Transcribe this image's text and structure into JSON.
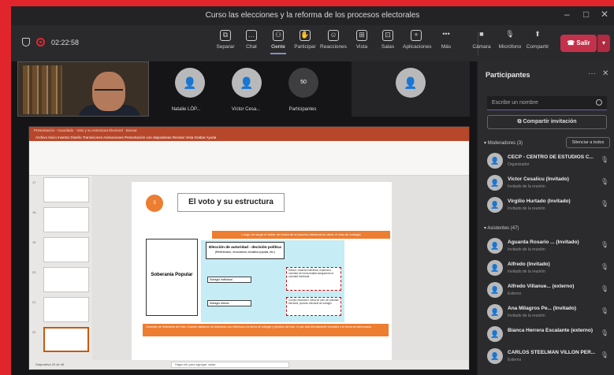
{
  "window": {
    "title": "Curso las elecciones y la reforma de los procesos electorales",
    "min": "–",
    "max": "□",
    "close": "✕"
  },
  "toolbar": {
    "timer": "02:22:58",
    "buttons": [
      {
        "label": "Separar",
        "icon": "⧉"
      },
      {
        "label": "Chat",
        "icon": "…"
      },
      {
        "label": "Gente",
        "icon": "⚇"
      },
      {
        "label": "Participar",
        "icon": "✋"
      },
      {
        "label": "Reacciones",
        "icon": "☺"
      },
      {
        "label": "Vista",
        "icon": "⊞"
      },
      {
        "label": "Salas",
        "icon": "⊡"
      },
      {
        "label": "Aplicaciones",
        "icon": "+"
      },
      {
        "label": "Más",
        "icon": "•••"
      }
    ],
    "device_buttons": [
      {
        "label": "Cámara",
        "icon": "■"
      },
      {
        "label": "Micrófono",
        "icon": "🎙"
      },
      {
        "label": "Compartir",
        "icon": "⬆"
      }
    ],
    "leave_label": "Salir",
    "leave_icon": "☎"
  },
  "stage": {
    "tiles": [
      {
        "name": "Natalie LÓP...",
        "icon": "👤"
      },
      {
        "name": "Víctor Cesa...",
        "icon": "👤"
      },
      {
        "name": "Participantes",
        "count": "50"
      },
      {
        "name": "",
        "icon": "👤"
      }
    ]
  },
  "powerpoint": {
    "titlebar": "Presentación - Guardado",
    "file_name": "Voto y su estructura Electoral",
    "search": "Buscar",
    "menu": "Archivo   Inicio   Insertar   Diseño   Transiciones   Animaciones   Presentación con diapositivas   Revisar   Vista   Grabar   Ayuda",
    "slide_numbers": [
      "17",
      "18",
      "19",
      "20",
      "21",
      "22"
    ],
    "slide": {
      "badge": "3",
      "title": "El voto y su estructura",
      "orange_bar": "Luego de surgir el deber de forma de el proceso electoral es decir, el voto de sufragio",
      "soberania": "Soberanía Popular",
      "eleccion": "Elección de autoridad - decisión política",
      "eleccion_sub": "(Referéndum, revocatoria, iniciativa popular, etc.)",
      "box_a": "Sufragio individual",
      "box_b": "Sufragio directo",
      "right_a": "Elector, votación individual, expresa la voluntad de forma estatal asegurando la voluntad individual",
      "right_b": "Cuerpo electoral o mesa de voto de voluntad electoral, proceso electoral de sufragio",
      "bottom_orange": "Concepto de Soberanía del Voto: Cuando hablamos de soberanía nos referimos a la forma de sufragio y ejercicio del voto, lo que está directamente vinculado a la forma de democracia."
    },
    "status": "Diapositiva 20 de 46",
    "notes": "Haga clic para agregar notas"
  },
  "panel": {
    "title": "Participantes",
    "search_placeholder": "Escribe un nombre",
    "invite": "Compartir invitación",
    "moderators_label": "Moderadores (3)",
    "mute_all": "Silenciar a todos",
    "moderators": [
      {
        "name": "CECP - CENTRO DE ESTUDIOS C...",
        "role": "Organizador"
      },
      {
        "name": "Victor Cesalicu (Invitado)",
        "role": "Invitado de la reunión"
      },
      {
        "name": "Virgilio Hurtado (Invitado)",
        "role": "Invitado de la reunión"
      }
    ],
    "attendees_label": "Asistentes (47)",
    "attendees": [
      {
        "name": "Aguarda Rosario ... (Invitado)",
        "role": "Invitado de la reunión"
      },
      {
        "name": "Alfredo (Invitado)",
        "role": "Invitado de la reunión"
      },
      {
        "name": "Alfredo Villanue... (externo)",
        "role": "Externo"
      },
      {
        "name": "Ana Milagros Pe... (Invitado)",
        "role": "Invitado de la reunión"
      },
      {
        "name": "Bianca Herrera Escalante (externo)",
        "role": ""
      },
      {
        "name": "CARLOS STEELMAN VILLON PER...",
        "role": "Externo"
      }
    ]
  },
  "colors": {
    "accent": "#6264a7",
    "leave": "#c4314b",
    "frame_border": "#e0262c",
    "slide_orange": "#ed7d31"
  }
}
